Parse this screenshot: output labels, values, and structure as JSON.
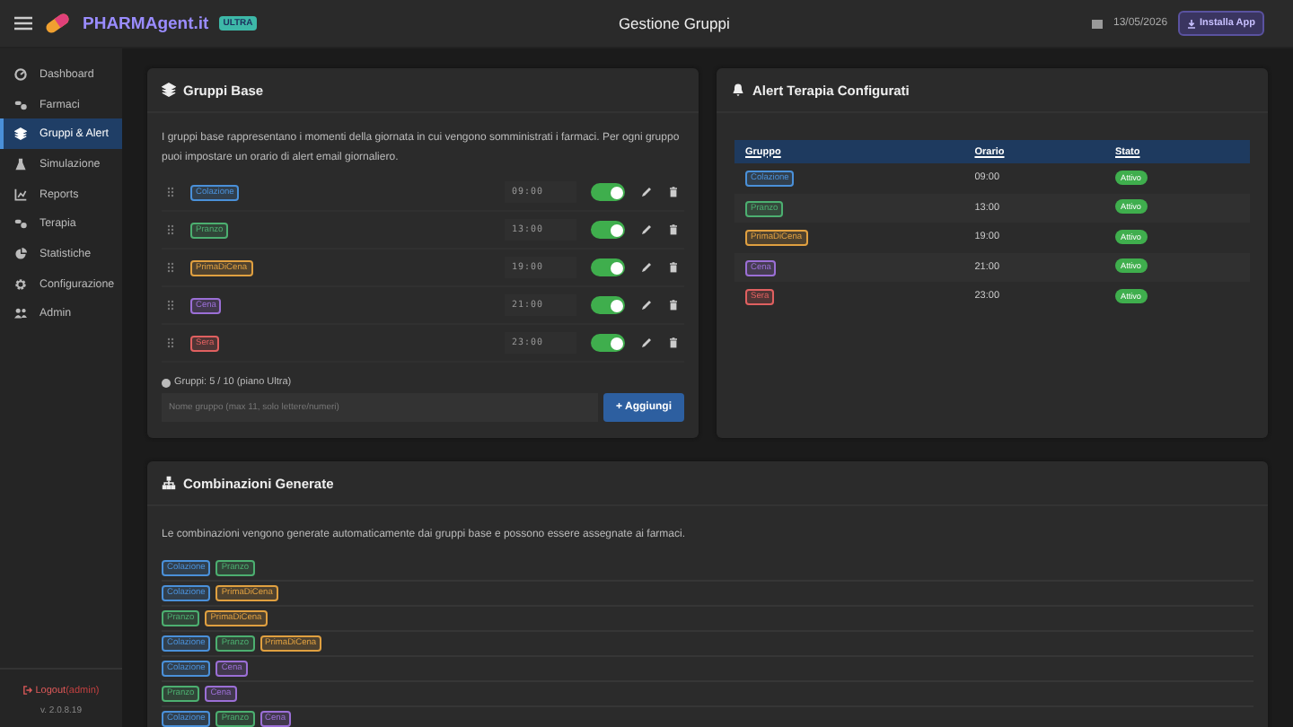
{
  "header": {
    "brand": "PHARMAgent.it",
    "plan_badge": "ULTRA",
    "title": "Gestione Gruppi",
    "date": "13/05/2026",
    "install_button": "Installa App"
  },
  "sidebar": {
    "items": [
      {
        "label": "Dashboard",
        "selected": false
      },
      {
        "label": "Farmaci",
        "selected": false
      },
      {
        "label": "Gruppi & Alert",
        "selected": true
      },
      {
        "label": "Simulazione",
        "selected": false
      },
      {
        "label": "Reports",
        "selected": false
      },
      {
        "label": "Terapia",
        "selected": false
      },
      {
        "label": "Statistiche",
        "selected": false
      },
      {
        "label": "Configurazione",
        "selected": false
      },
      {
        "label": "Admin",
        "selected": false
      }
    ],
    "logout": "Logout",
    "user": "(admin)",
    "version": "v. 2.0.8.19"
  },
  "groups_card": {
    "title": "Gruppi Base",
    "description": "I gruppi base rappresentano i momenti della giornata in cui vengono somministrati i farmaci. Per ogni gruppo puoi impostare un orario di alert email giornaliero.",
    "groups": [
      {
        "name": "Colazione",
        "color": "#4a90d9",
        "time": "09:00",
        "on": true
      },
      {
        "name": "Pranzo",
        "color": "#4caf70",
        "time": "13:00",
        "on": true
      },
      {
        "name": "PrimaDiCena",
        "color": "#e0a040",
        "time": "19:00",
        "on": true
      },
      {
        "name": "Cena",
        "color": "#9b6fd6",
        "time": "21:00",
        "on": true
      },
      {
        "name": "Sera",
        "color": "#e06060",
        "time": "23:00",
        "on": true
      }
    ],
    "count": "Gruppi: 5 / 10 (piano Ultra)",
    "input": {
      "placeholder": "Nome gruppo (max 11, solo lettere/numeri)"
    },
    "add_button": "+ Aggiungi"
  },
  "alerts_card": {
    "title": "Alert Terapia Configurati",
    "columns": [
      "Gruppo",
      "Orario",
      "Stato"
    ],
    "rows": [
      {
        "group": "Colazione",
        "color": "#4a90d9",
        "time": "09:00",
        "status": "Attivo"
      },
      {
        "group": "Pranzo",
        "color": "#4caf70",
        "time": "13:00",
        "status": "Attivo"
      },
      {
        "group": "PrimaDiCena",
        "color": "#e0a040",
        "time": "19:00",
        "status": "Attivo"
      },
      {
        "group": "Cena",
        "color": "#9b6fd6",
        "time": "21:00",
        "status": "Attivo"
      },
      {
        "group": "Sera",
        "color": "#e06060",
        "time": "23:00",
        "status": "Attivo"
      }
    ]
  },
  "combinations_card": {
    "title": "Combinazioni Generate",
    "description": "Le combinazioni vengono generate automaticamente dai gruppi base e possono essere assegnate ai farmaci.",
    "rows": [
      [
        {
          "label": "Colazione",
          "color": "#4a90d9"
        },
        {
          "label": "Pranzo",
          "color": "#4caf70"
        }
      ],
      [
        {
          "label": "Colazione",
          "color": "#4a90d9"
        },
        {
          "label": "PrimaDiCena",
          "color": "#e0a040"
        }
      ],
      [
        {
          "label": "Pranzo",
          "color": "#4caf70"
        },
        {
          "label": "PrimaDiCena",
          "color": "#e0a040"
        }
      ],
      [
        {
          "label": "Colazione",
          "color": "#4a90d9"
        },
        {
          "label": "Pranzo",
          "color": "#4caf70"
        },
        {
          "label": "PrimaDiCena",
          "color": "#e0a040"
        }
      ],
      [
        {
          "label": "Colazione",
          "color": "#4a90d9"
        },
        {
          "label": "Cena",
          "color": "#9b6fd6"
        }
      ],
      [
        {
          "label": "Pranzo",
          "color": "#4caf70"
        },
        {
          "label": "Cena",
          "color": "#9b6fd6"
        }
      ],
      [
        {
          "label": "Colazione",
          "color": "#4a90d9"
        },
        {
          "label": "Pranzo",
          "color": "#4caf70"
        },
        {
          "label": "Cena",
          "color": "#9b6fd6"
        }
      ]
    ]
  }
}
